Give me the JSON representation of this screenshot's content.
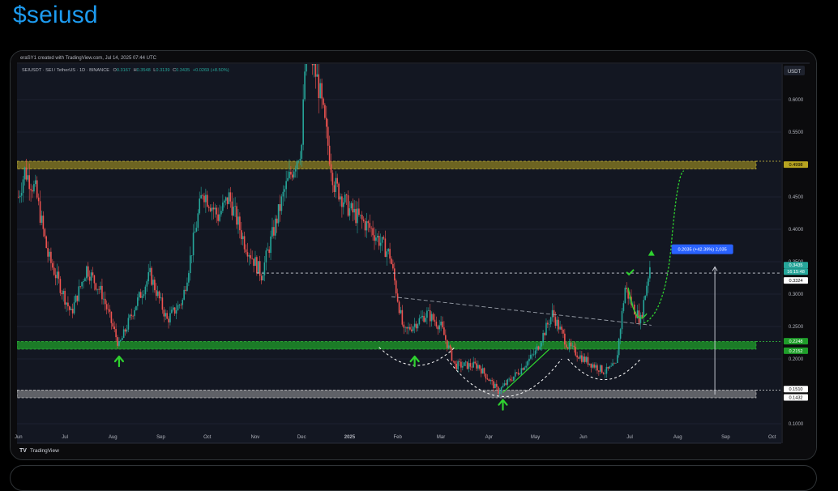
{
  "post": {
    "title": "$seiusd"
  },
  "chart_meta": {
    "created_by": "eraSY1 created with TradingView.com, Jul 14, 2025 07:44 UTC",
    "symbol_line": "SEIUSDT · SEI / TetherUS · 1D · BINANCE",
    "ohlc": {
      "o_label": "O",
      "o": "0.3167",
      "h_label": "H",
      "h": "0.3548",
      "l_label": "L",
      "l": "0.3139",
      "c_label": "C",
      "c": "0.3435",
      "change": "+0.0269 (+8.50%)"
    },
    "currency": "USDT",
    "logo_text": "TradingView"
  },
  "colors": {
    "background": "#0b0b0d",
    "up": "#26a69a",
    "down": "#ef5350",
    "resistance_zone": "#b8a420",
    "support_zone": "#1f9d2a",
    "bottom_zone": "#bdbdbd",
    "projection": "#2fd12f",
    "measure_label": "#2962ff",
    "arrow": "#2fd12f"
  },
  "chart_data": {
    "type": "candlestick",
    "title": "",
    "xlabel": "",
    "ylabel": "",
    "ylim": [
      0.07,
      0.655
    ],
    "x_ticks": [
      "Jun",
      "Jul",
      "Aug",
      "Sep",
      "Oct",
      "Nov",
      "Dec",
      "2025",
      "Feb",
      "Mar",
      "Apr",
      "May",
      "Jun",
      "Jul",
      "Aug",
      "Sep",
      "Oct"
    ],
    "y_ticks": [
      "0.6000",
      "0.5500",
      "0.4500",
      "0.4000",
      "0.3500",
      "0.3000",
      "0.2500",
      "0.2000",
      "0.1000"
    ],
    "price_path": [
      {
        "date": "2024-06-01",
        "price": 0.45
      },
      {
        "date": "2024-06-05",
        "price": 0.49
      },
      {
        "date": "2024-06-12",
        "price": 0.46
      },
      {
        "date": "2024-06-20",
        "price": 0.36
      },
      {
        "date": "2024-07-05",
        "price": 0.27
      },
      {
        "date": "2024-07-15",
        "price": 0.34
      },
      {
        "date": "2024-07-25",
        "price": 0.3
      },
      {
        "date": "2024-08-05",
        "price": 0.22
      },
      {
        "date": "2024-08-15",
        "price": 0.28
      },
      {
        "date": "2024-08-25",
        "price": 0.33
      },
      {
        "date": "2024-09-05",
        "price": 0.26
      },
      {
        "date": "2024-09-15",
        "price": 0.29
      },
      {
        "date": "2024-09-28",
        "price": 0.46
      },
      {
        "date": "2024-10-08",
        "price": 0.42
      },
      {
        "date": "2024-10-15",
        "price": 0.45
      },
      {
        "date": "2024-10-25",
        "price": 0.38
      },
      {
        "date": "2024-11-05",
        "price": 0.33
      },
      {
        "date": "2024-11-20",
        "price": 0.46
      },
      {
        "date": "2024-12-01",
        "price": 0.53
      },
      {
        "date": "2024-12-04",
        "price": 0.7
      },
      {
        "date": "2024-12-12",
        "price": 0.62
      },
      {
        "date": "2024-12-22",
        "price": 0.47
      },
      {
        "date": "2025-01-01",
        "price": 0.43
      },
      {
        "date": "2025-01-15",
        "price": 0.4
      },
      {
        "date": "2025-01-27",
        "price": 0.36
      },
      {
        "date": "2025-02-05",
        "price": 0.24
      },
      {
        "date": "2025-02-20",
        "price": 0.27
      },
      {
        "date": "2025-03-01",
        "price": 0.25
      },
      {
        "date": "2025-03-10",
        "price": 0.19
      },
      {
        "date": "2025-03-25",
        "price": 0.19
      },
      {
        "date": "2025-04-07",
        "price": 0.15
      },
      {
        "date": "2025-04-20",
        "price": 0.18
      },
      {
        "date": "2025-05-01",
        "price": 0.21
      },
      {
        "date": "2025-05-12",
        "price": 0.27
      },
      {
        "date": "2025-05-22",
        "price": 0.22
      },
      {
        "date": "2025-06-01",
        "price": 0.2
      },
      {
        "date": "2025-06-15",
        "price": 0.18
      },
      {
        "date": "2025-06-22",
        "price": 0.19
      },
      {
        "date": "2025-06-28",
        "price": 0.31
      },
      {
        "date": "2025-07-03",
        "price": 0.28
      },
      {
        "date": "2025-07-08",
        "price": 0.26
      },
      {
        "date": "2025-07-14",
        "price": 0.3435
      }
    ],
    "levels": [
      {
        "value": "0.4998",
        "kind": "resistance-zone",
        "low": 0.493,
        "high": 0.505
      },
      {
        "value": "0.3324",
        "kind": "dashed-line"
      },
      {
        "value": "0.2248",
        "kind": "support-zone-top",
        "low": 0.215,
        "high": 0.227
      },
      {
        "value": "0.2152",
        "kind": "support-zone-bottom"
      },
      {
        "value": "0.1510",
        "kind": "bottom-zone-top",
        "low": 0.14,
        "high": 0.152
      },
      {
        "value": "0.1432",
        "kind": "bottom-zone-bottom"
      }
    ],
    "last_price": {
      "value": "0.3435",
      "countdown": "16:15:48"
    },
    "measure_label": "0.2035 (+42.39%) 2,035"
  }
}
